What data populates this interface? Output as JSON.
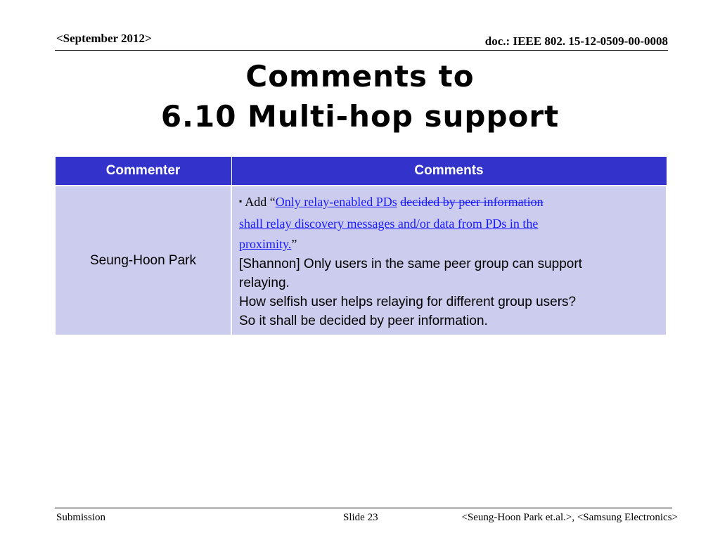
{
  "header": {
    "date": "<September 2012>",
    "doc_id": "doc.: IEEE 802. 15-12-0509-00-0008"
  },
  "title": {
    "line1": "Comments to",
    "line2": "6.10 Multi-hop support"
  },
  "table": {
    "headers": [
      "Commenter",
      "Comments"
    ],
    "rows": [
      {
        "commenter": "Seung-Hoon Park",
        "comment": {
          "bullet": "▪",
          "prefix": "Add “",
          "link1": "Only relay-enabled PDs",
          "space": " ",
          "struck": "decided by peer information",
          "link2": "shall relay discovery messages and/or data from PDs in the",
          "link3": "proximity.",
          "suffix": "”",
          "line4": "[Shannon] Only users in the same peer group can support",
          "line5": "relaying.",
          "line6": "How selfish user helps relaying for different group users?",
          "line7": "So it shall be decided by peer information."
        }
      }
    ]
  },
  "footer": {
    "left": "Submission",
    "center": "Slide 23",
    "right": "<Seung-Hoon Park et.al.>, <Samsung Electronics>"
  }
}
